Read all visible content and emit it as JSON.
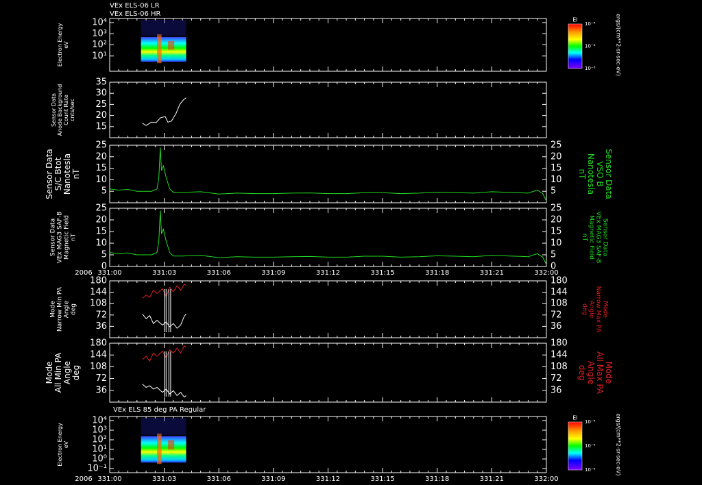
{
  "header": {
    "line1": "VEx ELS-06 LR",
    "line2": "VEx ELS-06 HR"
  },
  "colors": {
    "axis": "#ffffff",
    "mag": "#22dd22",
    "maxpa": "#dd2222",
    "minpa": "#ffffff"
  },
  "time_axis": {
    "year_label": "2006",
    "ticks": [
      "331:00",
      "331:03",
      "331:06",
      "331:09",
      "331:12",
      "331:15",
      "331:18",
      "331:21",
      "332:00"
    ]
  },
  "chart_data": [
    {
      "id": "spec1",
      "type": "heatmap",
      "ylabel": [
        "Electron Energy",
        "eV"
      ],
      "yscale": "log",
      "yticks": [
        "10⁴",
        "10³",
        "10²",
        "10¹"
      ],
      "colorbar": {
        "label": "EI",
        "ticks": [
          "10⁻⁴",
          "10⁻⁶",
          "10⁻⁸"
        ],
        "units": "ergs/(cm**2-sr-sec-eV)"
      }
    },
    {
      "id": "bkg",
      "type": "line",
      "ylabel": [
        "Sensor Data",
        "Anode Background",
        "Count Rate",
        "cnts/sec"
      ],
      "ylim": [
        10,
        35
      ],
      "yticks": [
        "35",
        "30",
        "25",
        "20",
        "15"
      ],
      "series": [
        {
          "x_hours": [
            1.8,
            2.0,
            2.3,
            2.55,
            2.8,
            3.05,
            3.2,
            3.4,
            3.65,
            3.85,
            4.05,
            4.2
          ],
          "values": [
            16.5,
            15.5,
            17.0,
            16.8,
            19.0,
            19.5,
            17.0,
            17.5,
            21.0,
            25.0,
            27.0,
            28.0
          ]
        }
      ]
    },
    {
      "id": "vsob",
      "type": "line",
      "ylabel": [
        "Sensor Data",
        "S/C Btot",
        "Nanotesla",
        "nT"
      ],
      "ylabel_right": [
        "Sensor Data",
        "VSO B",
        "Nanotesla",
        "nT"
      ],
      "ylim": [
        0,
        25
      ],
      "yticks": [
        "25",
        "20",
        "15",
        "10",
        "5"
      ],
      "series": [
        {
          "x_hours": [
            0.0,
            0.5,
            1.0,
            1.5,
            2.0,
            2.3,
            2.6,
            2.7,
            2.78,
            2.85,
            2.95,
            3.1,
            3.3,
            3.5,
            4.0,
            5.0,
            6.0,
            7.0,
            8.0,
            9.0,
            10.0,
            11.0,
            12.0,
            13.0,
            14.0,
            15.0,
            16.0,
            17.0,
            18.0,
            19.0,
            20.0,
            21.0,
            22.0,
            23.0,
            23.5,
            23.8,
            24.0
          ],
          "values": [
            6.0,
            5.5,
            5.8,
            5.0,
            5.0,
            5.0,
            6.0,
            11.0,
            24.0,
            14.0,
            16.0,
            11.0,
            6.0,
            4.5,
            4.5,
            4.8,
            3.8,
            4.2,
            4.0,
            4.0,
            4.2,
            4.3,
            4.0,
            4.0,
            4.4,
            4.4,
            4.0,
            4.2,
            4.6,
            4.4,
            4.2,
            4.8,
            4.5,
            4.2,
            5.5,
            4.0,
            0.8
          ]
        }
      ]
    },
    {
      "id": "mag",
      "type": "line",
      "ylabel": [
        "Sensor Data",
        "VEx MAG3 SAF-B",
        "Magnetic Field",
        "nT"
      ],
      "ylabel_right": [
        "Sensor Data",
        "VEx MAG3 SAF-B",
        "Magnetic Field",
        "nT"
      ],
      "ylim": [
        0,
        25
      ],
      "yticks": [
        "25",
        "20",
        "15",
        "10",
        "5",
        "0"
      ]
    },
    {
      "id": "narrow",
      "type": "line",
      "ylabel": [
        "Mode",
        "Narrow Min PA",
        "Angle",
        "deg"
      ],
      "ylabel_right": [
        "Mode",
        "Narrow Max PA",
        "Angle",
        "deg"
      ],
      "ylim": [
        0,
        180
      ],
      "yticks": [
        "180",
        "144",
        "108",
        "72",
        "36"
      ],
      "series": [
        {
          "x_hours": [
            1.8,
            2.0,
            2.2,
            2.4,
            2.6,
            2.9,
            3.1,
            3.3,
            3.5,
            3.7,
            3.9,
            4.1,
            4.2
          ],
          "values": [
            125,
            135,
            128,
            150,
            140,
            155,
            130,
            160,
            145,
            165,
            150,
            170,
            165
          ]
        },
        {
          "x_hours": [
            1.8,
            2.0,
            2.2,
            2.4,
            2.6,
            2.9,
            3.1,
            3.3,
            3.5,
            3.7,
            3.9,
            4.1,
            4.2
          ],
          "values": [
            75,
            60,
            70,
            45,
            55,
            40,
            50,
            35,
            45,
            30,
            40,
            68,
            75
          ]
        }
      ]
    },
    {
      "id": "all",
      "type": "line",
      "ylabel": [
        "Mode",
        "All Min PA",
        "Angle",
        "deg"
      ],
      "ylabel_right": [
        "Mode",
        "All Max PA",
        "Angle",
        "deg"
      ],
      "ylim": [
        0,
        180
      ],
      "yticks": [
        "180",
        "144",
        "108",
        "72",
        "36"
      ],
      "series": [
        {
          "x_hours": [
            1.8,
            2.0,
            2.2,
            2.4,
            2.6,
            2.9,
            3.1,
            3.3,
            3.5,
            3.7,
            3.9,
            4.1,
            4.2
          ],
          "values": [
            130,
            140,
            125,
            150,
            140,
            155,
            135,
            160,
            150,
            165,
            150,
            172,
            168
          ]
        },
        {
          "x_hours": [
            1.8,
            2.0,
            2.2,
            2.4,
            2.6,
            2.9,
            3.1,
            3.3,
            3.5,
            3.7,
            3.9,
            4.1,
            4.2
          ],
          "values": [
            55,
            45,
            50,
            40,
            45,
            30,
            40,
            25,
            35,
            20,
            30,
            15,
            20
          ]
        }
      ]
    },
    {
      "id": "spec2",
      "type": "heatmap",
      "title": "VEx ELS 85 deg PA Regular",
      "ylabel": [
        "Electron Energy",
        "eV"
      ],
      "yscale": "log",
      "yticks": [
        "10⁴",
        "10³",
        "10²",
        "10¹",
        "10⁰",
        "10⁻¹"
      ],
      "colorbar": {
        "label": "EI",
        "ticks": [
          "10⁻⁴",
          "10⁻⁶",
          "10⁻⁸"
        ],
        "units": "ergs/(cm**2-sr-sec-eV)"
      }
    }
  ]
}
